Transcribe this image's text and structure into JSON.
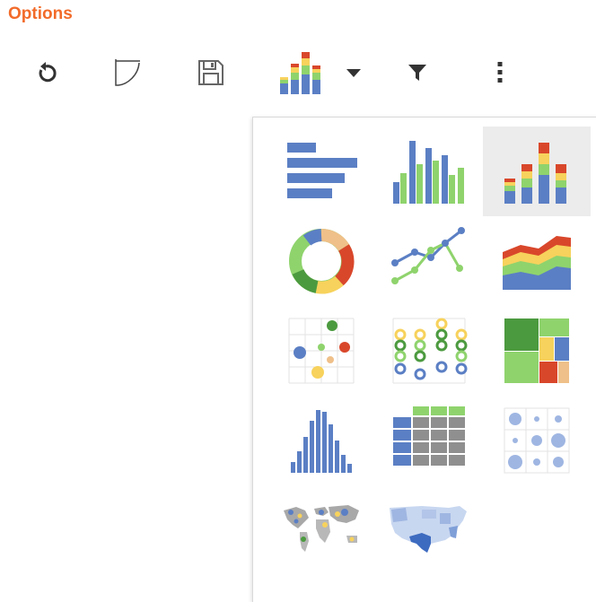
{
  "header": {
    "title": "Options"
  },
  "toolbar": {
    "buttons": [
      {
        "icon": "refresh-icon"
      },
      {
        "icon": "redraw-icon"
      },
      {
        "icon": "save-icon"
      },
      {
        "icon": "chart-type-icon",
        "dropdown": "chevron-down-icon"
      },
      {
        "icon": "filter-icon"
      },
      {
        "icon": "more-vert-icon"
      }
    ]
  },
  "chart_picker": {
    "selected": "stacked-bar-chart-icon",
    "options": [
      {
        "icon": "horizontal-bar-chart-icon"
      },
      {
        "icon": "grouped-bar-chart-icon"
      },
      {
        "icon": "stacked-bar-chart-icon"
      },
      {
        "icon": "donut-chart-icon"
      },
      {
        "icon": "line-chart-icon"
      },
      {
        "icon": "stacked-area-chart-icon"
      },
      {
        "icon": "scatter-chart-icon"
      },
      {
        "icon": "dot-grid-chart-icon"
      },
      {
        "icon": "treemap-chart-icon"
      },
      {
        "icon": "histogram-chart-icon"
      },
      {
        "icon": "table-chart-icon"
      },
      {
        "icon": "bubble-grid-chart-icon"
      },
      {
        "icon": "world-map-chart-icon"
      },
      {
        "icon": "us-map-chart-icon"
      }
    ]
  },
  "colors": {
    "brand_orange": "#f26b2a",
    "blue": "#5b7fc4",
    "green": "#8fd36d",
    "dark_green": "#4c9a3f",
    "yellow": "#f7d25c",
    "red": "#d9472b",
    "tan": "#efc089",
    "gray": "#8f8f8f"
  }
}
